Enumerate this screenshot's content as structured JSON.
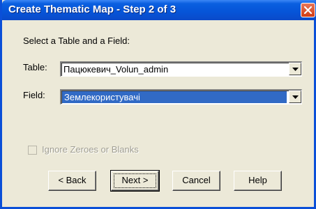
{
  "window": {
    "title": "Create Thematic Map - Step 2 of 3",
    "close_icon": "close-icon"
  },
  "form": {
    "instruction": "Select a Table and a Field:",
    "table_label": "Table:",
    "table_value": "Пацюкевич_Volun_admin",
    "field_label": "Field:",
    "field_value": "Землекористувачі",
    "ignore_label": "Ignore Zeroes or Blanks",
    "ignore_checked": false
  },
  "buttons": {
    "back": "< Back",
    "next": "Next >",
    "cancel": "Cancel",
    "help": "Help"
  },
  "colors": {
    "title_bar": "#0654d8",
    "close_button": "#d23c12",
    "selection": "#316ac5",
    "dialog_bg": "#ece9d8"
  }
}
